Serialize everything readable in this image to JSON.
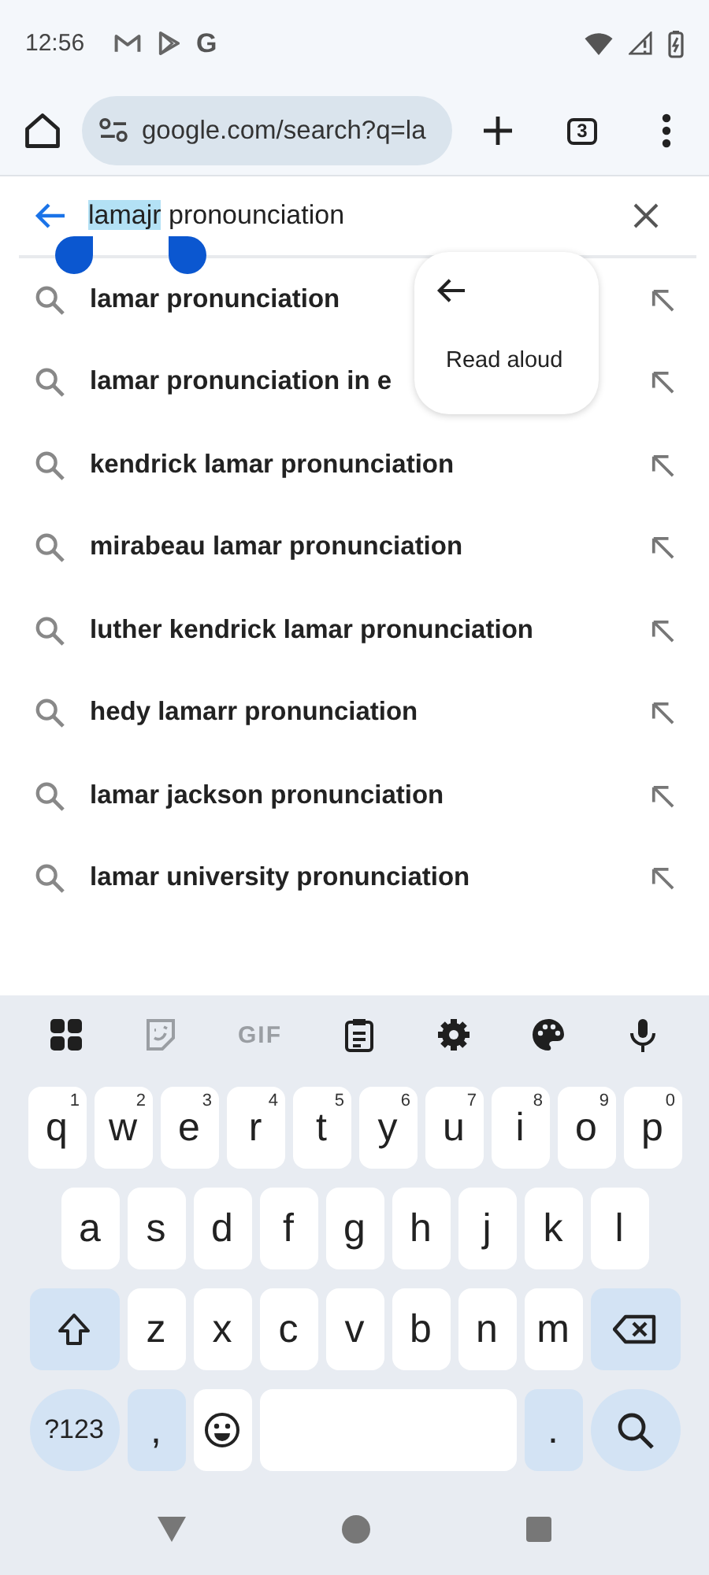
{
  "status_bar": {
    "time": "12:56",
    "notification_letter": "G"
  },
  "toolbar": {
    "url": "google.com/search?q=la",
    "tab_count": "3"
  },
  "search": {
    "query": [
      {
        "text": "lamajr",
        "selected": true
      },
      {
        "text": " pronounciation",
        "selected": false
      }
    ]
  },
  "suggestions": [
    "lamar pronunciation",
    "lamar pronunciation in e",
    "kendrick lamar pronunciation",
    "mirabeau lamar pronunciation",
    "luther kendrick lamar pronunciation",
    "hedy lamarr pronunciation",
    "lamar jackson pronunciation",
    "lamar university pronunciation"
  ],
  "popup": {
    "label": "Read aloud"
  },
  "keyboard": {
    "tools": [
      {
        "kind": "apps",
        "disabled": false
      },
      {
        "kind": "sticker",
        "disabled": true
      },
      {
        "kind": "gif",
        "label": "GIF",
        "disabled": true
      },
      {
        "kind": "clipboard",
        "disabled": false
      },
      {
        "kind": "settings",
        "disabled": false
      },
      {
        "kind": "theme",
        "disabled": false
      },
      {
        "kind": "mic",
        "disabled": false
      }
    ],
    "rows": [
      {
        "keys": [
          {
            "kind": "letter",
            "label": "q",
            "hint": "1"
          },
          {
            "kind": "letter",
            "label": "w",
            "hint": "2"
          },
          {
            "kind": "letter",
            "label": "e",
            "hint": "3"
          },
          {
            "kind": "letter",
            "label": "r",
            "hint": "4"
          },
          {
            "kind": "letter",
            "label": "t",
            "hint": "5"
          },
          {
            "kind": "letter",
            "label": "y",
            "hint": "6"
          },
          {
            "kind": "letter",
            "label": "u",
            "hint": "7"
          },
          {
            "kind": "letter",
            "label": "i",
            "hint": "8"
          },
          {
            "kind": "letter",
            "label": "o",
            "hint": "9"
          },
          {
            "kind": "letter",
            "label": "p",
            "hint": "0"
          }
        ]
      },
      {
        "keys": [
          {
            "kind": "letter",
            "label": "a"
          },
          {
            "kind": "letter",
            "label": "s"
          },
          {
            "kind": "letter",
            "label": "d"
          },
          {
            "kind": "letter",
            "label": "f"
          },
          {
            "kind": "letter",
            "label": "g"
          },
          {
            "kind": "letter",
            "label": "h"
          },
          {
            "kind": "letter",
            "label": "j"
          },
          {
            "kind": "letter",
            "label": "k"
          },
          {
            "kind": "letter",
            "label": "l"
          }
        ]
      },
      {
        "keys": [
          {
            "kind": "shift"
          },
          {
            "kind": "letter",
            "label": "z"
          },
          {
            "kind": "letter",
            "label": "x"
          },
          {
            "kind": "letter",
            "label": "c"
          },
          {
            "kind": "letter",
            "label": "v"
          },
          {
            "kind": "letter",
            "label": "b"
          },
          {
            "kind": "letter",
            "label": "n"
          },
          {
            "kind": "letter",
            "label": "m"
          },
          {
            "kind": "backspace"
          }
        ]
      },
      {
        "keys": [
          {
            "kind": "symbols",
            "label": "?123"
          },
          {
            "kind": "comma",
            "label": ","
          },
          {
            "kind": "emoji"
          },
          {
            "kind": "space"
          },
          {
            "kind": "period",
            "label": "."
          },
          {
            "kind": "search"
          }
        ]
      }
    ]
  }
}
